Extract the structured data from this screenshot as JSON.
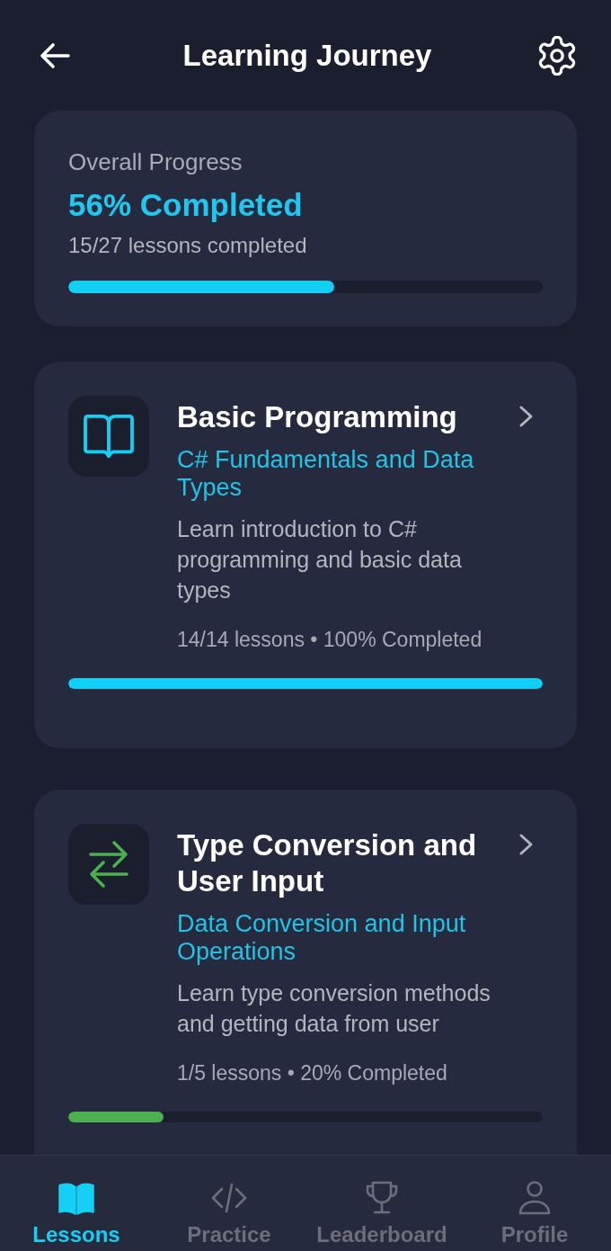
{
  "header": {
    "title": "Learning Journey"
  },
  "overall_progress": {
    "label": "Overall Progress",
    "summary": "56% Completed",
    "lessons": "15/27 lessons completed",
    "level": 0.56
  },
  "courses": [
    {
      "title": "Basic Programming",
      "subtitle": "C# Fundamentals and Data Types",
      "description": "Learn introduction to C# programming and basic data types",
      "meta": "14/14 lessons • 100% Completed",
      "level": 1,
      "color": "#12d0f5"
    },
    {
      "title": "Type Conversion and User Input",
      "subtitle": "Data Conversion and Input Operations",
      "description": "Learn type conversion methods and getting data from user",
      "meta": "1/5 lessons • 20% Completed",
      "level": 0.2,
      "color": "#4caf50"
    }
  ],
  "bottom_nav": [
    {
      "label": "Lessons",
      "selected": true
    },
    {
      "label": "Practice",
      "selected": false
    },
    {
      "label": "Leaderboard",
      "selected": false
    },
    {
      "label": "Profile",
      "selected": false
    }
  ]
}
